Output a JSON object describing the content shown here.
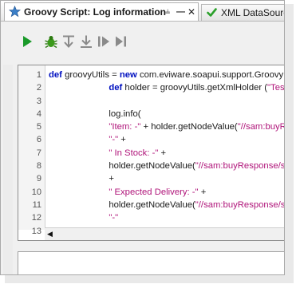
{
  "tabs": [
    {
      "title": "Groovy Script: Log information",
      "icon": "star-icon",
      "active": true
    },
    {
      "title": "XML DataSource",
      "icon": "checkmark-icon",
      "active": false
    }
  ],
  "tab_controls": {
    "pin": "pin-icon",
    "minimize": "minimize-icon",
    "close": "close-icon"
  },
  "toolbar": [
    "run-icon",
    "debug-bug-icon",
    "step-over-icon",
    "step-into-icon",
    "step-resume-icon",
    "step-to-end-icon"
  ],
  "colors": {
    "run": "#1a9a2a",
    "debug": "#3a9a1a",
    "keyword": "#0010c0",
    "string": "#b0157a",
    "tab_star": "#3a7fc8",
    "check": "#2aa02a"
  },
  "editor": {
    "lines": [
      {
        "n": "1",
        "parts": [
          {
            "t": "def",
            "c": "kw"
          },
          {
            "t": " groovyUtils = ",
            "c": ""
          },
          {
            "t": "new",
            "c": "kw"
          },
          {
            "t": " com.eviware.soapui.support.GroovyUtils(context)",
            "c": ""
          }
        ]
      },
      {
        "n": "2",
        "parts": [
          {
            "t": "                        ",
            "c": ""
          },
          {
            "t": "def",
            "c": "kw"
          },
          {
            "t": " holder = groovyUtils.getXmlHolder (",
            "c": ""
          },
          {
            "t": "\"Test Request - buy#Response\"",
            "c": "str"
          },
          {
            "t": ")",
            "c": ""
          }
        ]
      },
      {
        "n": "3",
        "parts": []
      },
      {
        "n": "4",
        "parts": [
          {
            "t": "                        log.info(",
            "c": ""
          }
        ]
      },
      {
        "n": "5",
        "parts": [
          {
            "t": "                        ",
            "c": ""
          },
          {
            "t": "\"Item: -\"",
            "c": "str"
          },
          {
            "t": " + holder.getNodeValue(",
            "c": ""
          },
          {
            "t": "\"//sam:buyResponse/sam:buyResult\"",
            "c": "str"
          },
          {
            "t": ") +",
            "c": ""
          }
        ]
      },
      {
        "n": "6",
        "parts": [
          {
            "t": "                        ",
            "c": ""
          },
          {
            "t": "\"-\"",
            "c": "str"
          },
          {
            "t": " +",
            "c": ""
          }
        ]
      },
      {
        "n": "7",
        "parts": [
          {
            "t": "                        ",
            "c": ""
          },
          {
            "t": "\" In Stock: -\"",
            "c": "str"
          },
          {
            "t": " +",
            "c": ""
          }
        ]
      },
      {
        "n": "8",
        "parts": [
          {
            "t": "                        holder.getNodeValue(",
            "c": ""
          },
          {
            "t": "\"//sam:buyResponse/sam:buyResult\"",
            "c": "str"
          },
          {
            "t": ")",
            "c": ""
          }
        ]
      },
      {
        "n": "9",
        "parts": [
          {
            "t": "                        +",
            "c": ""
          }
        ]
      },
      {
        "n": "10",
        "parts": [
          {
            "t": "                        ",
            "c": ""
          },
          {
            "t": "\" Expected Delivery: -\"",
            "c": "str"
          },
          {
            "t": " +",
            "c": ""
          }
        ]
      },
      {
        "n": "11",
        "parts": [
          {
            "t": "                        holder.getNodeValue(",
            "c": ""
          },
          {
            "t": "\"//sam:buyResponse/sam:buyResult\"",
            "c": "str"
          },
          {
            "t": ")",
            "c": ""
          }
        ]
      },
      {
        "n": "12",
        "parts": [
          {
            "t": "                        ",
            "c": ""
          },
          {
            "t": "\"-\"",
            "c": "str"
          }
        ]
      },
      {
        "n": "13",
        "parts": [
          {
            "t": "                        )",
            "c": ""
          }
        ]
      },
      {
        "n": "14",
        "parts": []
      }
    ]
  }
}
